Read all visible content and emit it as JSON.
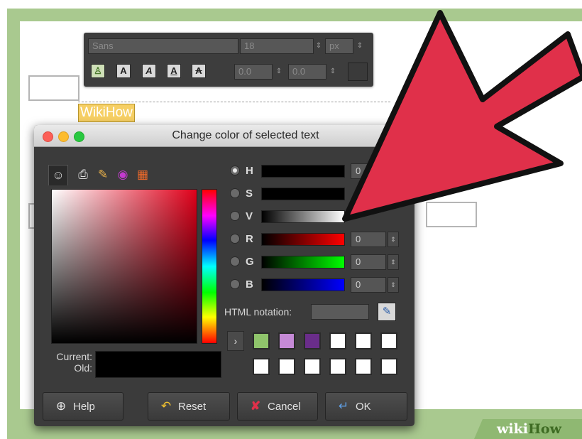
{
  "text_toolbar": {
    "font_name": "Sans",
    "font_size": "18",
    "unit": "px",
    "spacing_1": "0.0",
    "spacing_2": "0.0",
    "icons": [
      "clean-style-icon",
      "bold-icon",
      "italic-icon",
      "underline-icon",
      "strikethrough-icon"
    ]
  },
  "selected_text": "WikiHow",
  "dialog": {
    "title": "Change color of selected text",
    "tabs": [
      "gimp-icon",
      "printer-icon",
      "brush-icon",
      "color-wheel-icon",
      "palette-icon"
    ],
    "channels": [
      {
        "label": "H",
        "value": "0",
        "selected": true
      },
      {
        "label": "S",
        "value": "",
        "selected": false
      },
      {
        "label": "V",
        "value": "",
        "selected": false
      },
      {
        "label": "R",
        "value": "0",
        "selected": false
      },
      {
        "label": "G",
        "value": "0",
        "selected": false
      },
      {
        "label": "B",
        "value": "0",
        "selected": false
      }
    ],
    "html_notation_label": "HTML notation:",
    "html_notation_value": "",
    "current_label": "Current:",
    "old_label": "Old:",
    "history_swatches": [
      "#8fc46b",
      "#c58ad6",
      "#6a2d8a",
      "#ffffff",
      "#ffffff",
      "#ffffff",
      "#ffffff",
      "#ffffff",
      "#ffffff",
      "#ffffff",
      "#ffffff",
      "#ffffff"
    ],
    "buttons": {
      "help": "Help",
      "reset": "Reset",
      "cancel": "Cancel",
      "ok": "OK"
    }
  },
  "watermark": {
    "part1": "wiki",
    "part2": "How"
  },
  "colors": {
    "arrow": "#e0304a",
    "accent_green": "#a9c98f",
    "highlight": "#f6cf64"
  }
}
